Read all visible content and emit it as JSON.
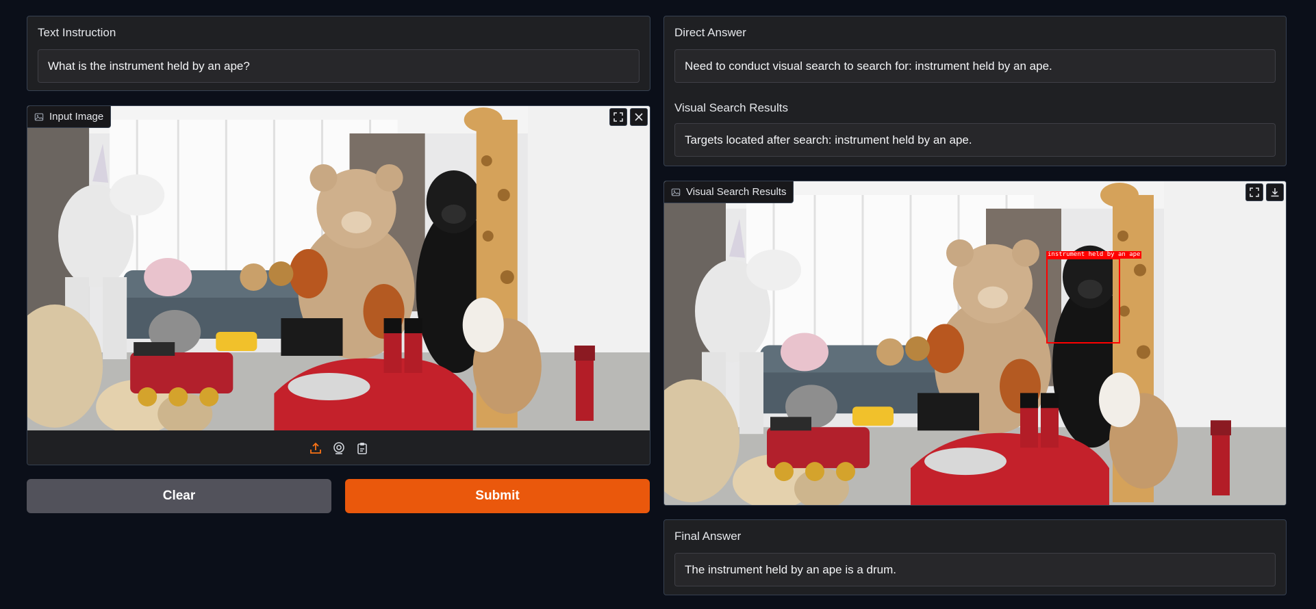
{
  "instruction": {
    "label": "Text Instruction",
    "value": "What is the instrument held by an ape?"
  },
  "input_image": {
    "label": "Input Image",
    "icons": [
      "image-icon",
      "fullscreen-icon",
      "close-icon",
      "upload-icon",
      "webcam-icon",
      "clipboard-icon"
    ]
  },
  "buttons": {
    "clear": "Clear",
    "submit": "Submit"
  },
  "direct_answer": {
    "label": "Direct Answer",
    "value": "Need to conduct visual search to search for: instrument held by an ape."
  },
  "visual_search_text": {
    "label": "Visual Search Results",
    "value": "Targets located after search: instrument held by an ape."
  },
  "visual_search_image": {
    "label": "Visual Search Results",
    "box_label": "instrument held by an ape",
    "icons": [
      "image-icon",
      "fullscreen-icon",
      "download-icon"
    ]
  },
  "final_answer": {
    "label": "Final Answer",
    "value": "The instrument held by an ape is a drum."
  },
  "colors": {
    "background": "#0b0f19",
    "panel": "#1f2023",
    "submit": "#ea580c",
    "clear": "#52525b",
    "detection_box": "#ff0000"
  }
}
